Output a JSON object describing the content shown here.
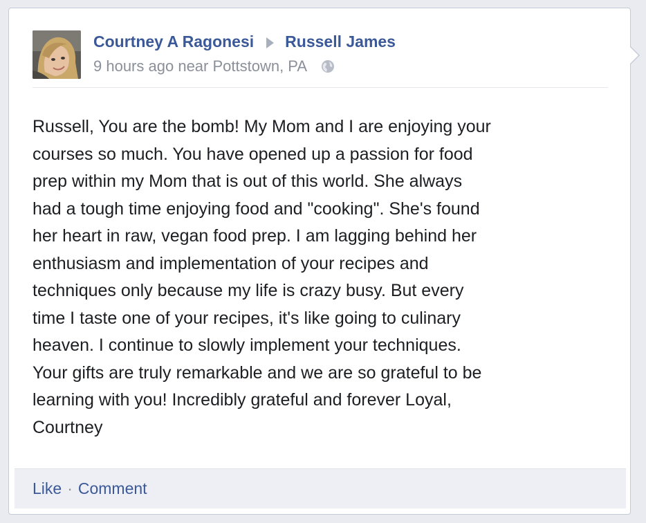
{
  "post": {
    "author": "Courtney A Ragonesi",
    "recipient": "Russell James",
    "time": "9 hours ago",
    "location": "near Pottstown, PA",
    "privacy_icon": "globe-icon",
    "text": "Russell, You are the bomb! My Mom and I are enjoying your\ncourses so much. You have opened up a passion for food\nprep within my Mom that is out of this world. She always\nhad a tough time enjoying food and \"cooking\". She's found\nher heart in raw, vegan food prep. I am lagging behind her\nenthusiasm and implementation of your recipes and\ntechniques only because my life is crazy busy. But every\ntime I taste one of your recipes, it's like going to culinary\nheaven. I continue to slowly implement your techniques.\nYour gifts are truly remarkable and we are so grateful to be\nlearning with you! Incredibly grateful and forever Loyal,\nCourtney"
  },
  "actions": {
    "like": "Like",
    "separator": "·",
    "comment": "Comment"
  },
  "colors": {
    "link": "#3b5998",
    "meta": "#8a8f99",
    "footer_bg": "#edeff4",
    "page_bg": "#e9ebf0"
  }
}
